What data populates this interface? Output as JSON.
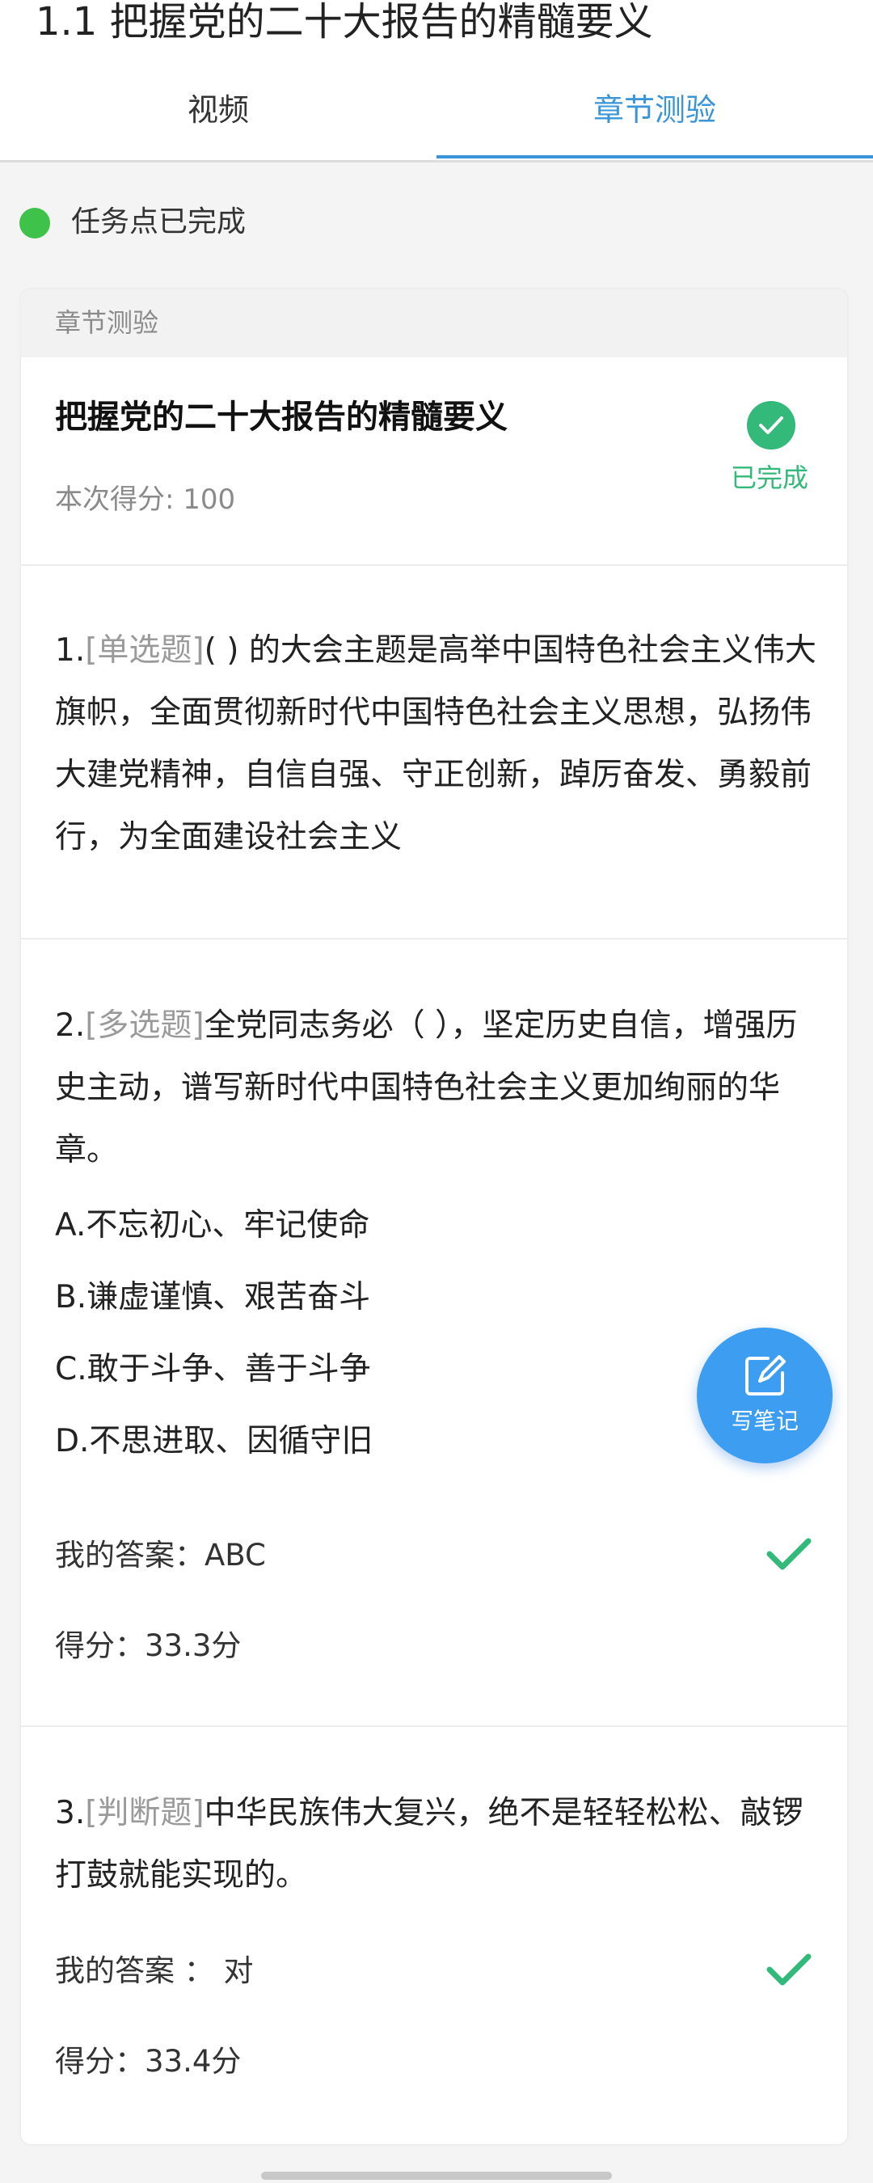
{
  "page": {
    "title": "1.1 把握党的二十大报告的精髓要义"
  },
  "tabs": [
    {
      "label": "视频",
      "active": false
    },
    {
      "label": "章节测验",
      "active": true
    }
  ],
  "task": {
    "status_text": "任务点已完成",
    "status_color": "#3fc24a"
  },
  "quiz": {
    "section_label": "章节测验",
    "title": "把握党的二十大报告的精髓要义",
    "score_summary": "本次得分: 100",
    "completed_label": "已完成",
    "accent_color": "#33b97a"
  },
  "questions": [
    {
      "number": "1.",
      "type": "[单选题]",
      "text": "( ) 的大会主题是高举中国特色社会主义伟大旗帜，全面贯彻新时代中国特色社会主义思想，弘扬伟大建党精神，自信自强、守正创新，踔厉奋发、勇毅前行，为全面建设社会主义"
    },
    {
      "number": "2.",
      "type": "[多选题]",
      "text": "全党同志务必（ ），坚定历史自信，增强历史主动，谱写新时代中国特色社会主义更加绚丽的华章。",
      "options": [
        "A.不忘初心、牢记使命",
        "B.谦虚谨慎、艰苦奋斗",
        "C.敢于斗争、善于斗争",
        "D.不思进取、因循守旧"
      ],
      "my_answer": "我的答案：ABC",
      "score": "得分：33.3分",
      "correct": true
    },
    {
      "number": "3.",
      "type": "[判断题]",
      "text": "中华民族伟大复兴，绝不是轻轻松松、敲锣打鼓就能实现的。",
      "my_answer": "我的答案 ： 对",
      "score": "得分：33.4分",
      "correct": true
    }
  ],
  "fab": {
    "label": "写笔记",
    "icon": "edit-note-icon",
    "color": "#3d9df0"
  }
}
